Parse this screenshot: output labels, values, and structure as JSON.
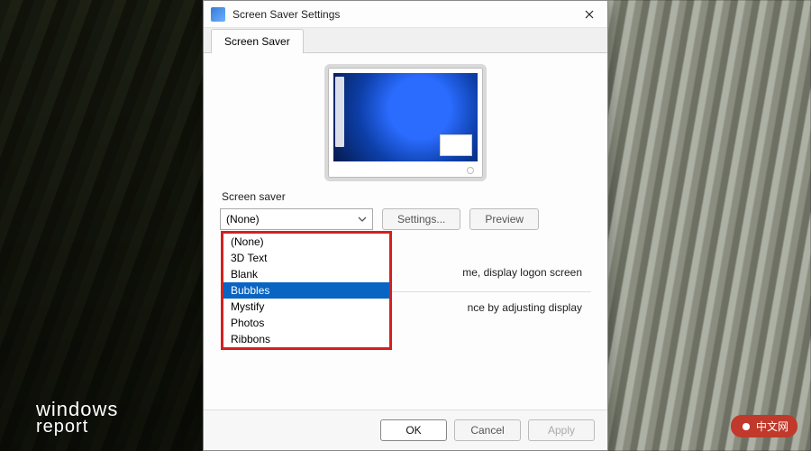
{
  "watermark": {
    "line1": "windows",
    "line2": "report",
    "badge": "中文网"
  },
  "window": {
    "title": "Screen Saver Settings",
    "tab": "Screen Saver",
    "group_label": "Screen saver",
    "combo_value": "(None)",
    "options": [
      "(None)",
      "3D Text",
      "Blank",
      "Bubbles",
      "Mystify",
      "Photos",
      "Ribbons"
    ],
    "selected_option": "Bubbles",
    "settings_btn": "Settings...",
    "preview_btn": "Preview",
    "resume_text_fragment": "me, display logon screen",
    "energy_text_fragment": "nce by adjusting display",
    "ok": "OK",
    "cancel": "Cancel",
    "apply": "Apply"
  }
}
